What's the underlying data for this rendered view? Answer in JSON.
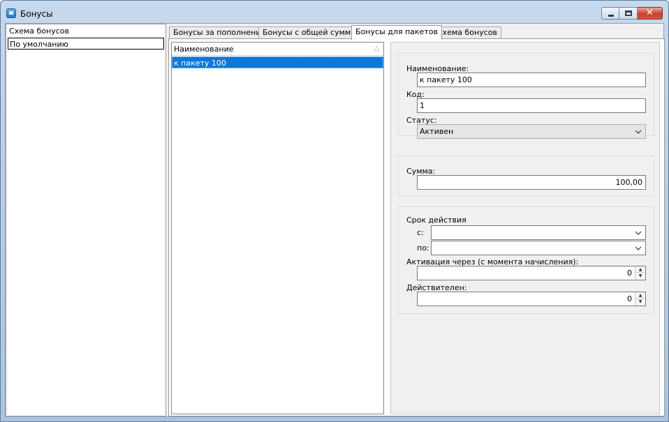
{
  "window": {
    "title": "Бонусы"
  },
  "schemes": {
    "items": [
      {
        "label": "Схема бонусов"
      },
      {
        "label": "По умолчанию"
      }
    ]
  },
  "tabs": [
    {
      "label": "Бонусы за пополнение",
      "active": false
    },
    {
      "label": "Бонусы с общей суммы",
      "active": false
    },
    {
      "label": "Бонусы для пакетов",
      "active": true
    },
    {
      "label": "Схема бонусов",
      "active": false
    }
  ],
  "grid": {
    "column": "Наименование",
    "rows": [
      {
        "name": "к пакету 100",
        "selected": true
      }
    ]
  },
  "form": {
    "name_label": "Наименование:",
    "name_value": "к пакету 100",
    "code_label": "Код:",
    "code_value": "1",
    "status_label": "Статус:",
    "status_value": "Активен",
    "sum_label": "Сумма:",
    "sum_value": "100,00",
    "period_label": "Срок действия",
    "from_label": "с:",
    "from_value": "",
    "to_label": "по:",
    "to_value": "",
    "activation_label": "Активация через (с момента начисления):",
    "activation_value": "0",
    "valid_label": "Действителен:",
    "valid_value": "0"
  },
  "colors": {
    "selection": "#0e78d7",
    "close_button": "#c8402a"
  }
}
